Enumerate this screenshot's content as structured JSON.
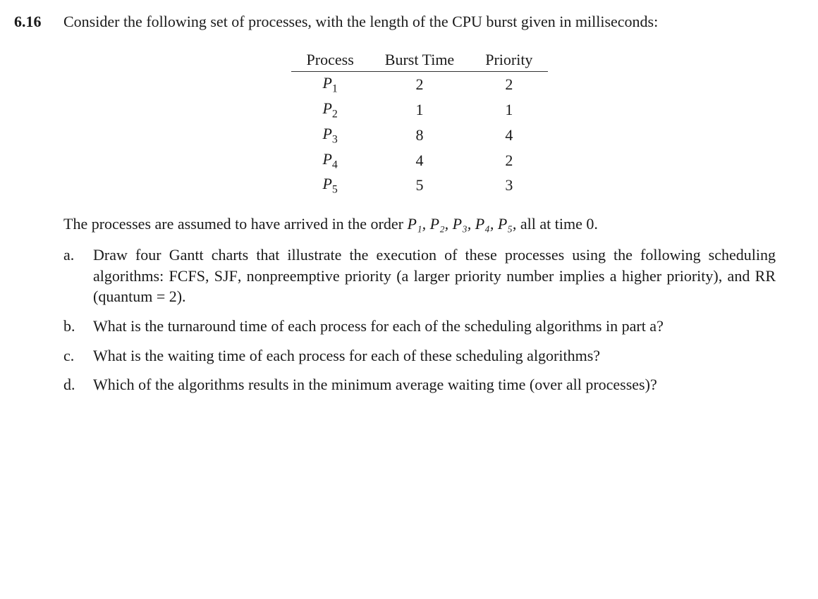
{
  "problem_number": "6.16",
  "intro": "Consider the following set of processes, with the length of the CPU burst given in milliseconds:",
  "table_headers": {
    "process": "Process",
    "burst": "Burst Time",
    "priority": "Priority"
  },
  "processes": [
    {
      "name_base": "P",
      "name_sub": "1",
      "burst": "2",
      "priority": "2"
    },
    {
      "name_base": "P",
      "name_sub": "2",
      "burst": "1",
      "priority": "1"
    },
    {
      "name_base": "P",
      "name_sub": "3",
      "burst": "8",
      "priority": "4"
    },
    {
      "name_base": "P",
      "name_sub": "4",
      "burst": "4",
      "priority": "2"
    },
    {
      "name_base": "P",
      "name_sub": "5",
      "burst": "5",
      "priority": "3"
    }
  ],
  "mid_pre": "The processes are assumed to have arrived in the order ",
  "mid_list": "P₁, P₂, P₃, P₄, P₅",
  "mid_post": ", all at time 0.",
  "parts": {
    "a": {
      "label": "a.",
      "pre": "Draw four Gantt charts that illustrate the execution of these processes using the following scheduling algorithms: ",
      "sc1": "FCFS",
      "mid1": ", ",
      "sc2": "SJF",
      "mid2": ", nonpreemptive priority (a larger priority number implies a higher priority), and ",
      "sc3": "RR",
      "post": " (quantum = 2)."
    },
    "b": {
      "label": "b.",
      "text": "What is the turnaround time of each process for each of the scheduling algorithms in part a?"
    },
    "c": {
      "label": "c.",
      "text": "What is the waiting time of each process for each of these scheduling algorithms?"
    },
    "d": {
      "label": "d.",
      "text": "Which of the algorithms results in the minimum average waiting time (over all processes)?"
    }
  }
}
